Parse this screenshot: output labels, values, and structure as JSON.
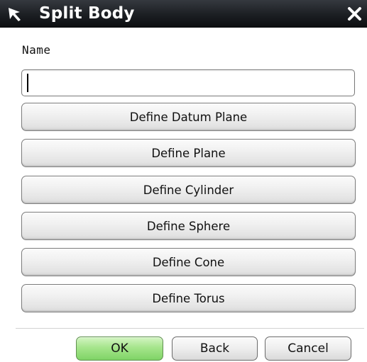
{
  "window": {
    "title": "Split Body",
    "title_icon": "cursor-arrow-icon",
    "close_icon": "close-x-icon"
  },
  "form": {
    "name_label": "Name",
    "name_value": ""
  },
  "define_buttons": [
    {
      "label": "Define Datum Plane"
    },
    {
      "label": "Define Plane"
    },
    {
      "label": "Define Cylinder"
    },
    {
      "label": "Define Sphere"
    },
    {
      "label": "Define Cone"
    },
    {
      "label": "Define Torus"
    }
  ],
  "footer": {
    "ok_label": "OK",
    "back_label": "Back",
    "cancel_label": "Cancel"
  },
  "colors": {
    "titlebar": "#1b1e22",
    "ok_button": "#a6e58c"
  }
}
